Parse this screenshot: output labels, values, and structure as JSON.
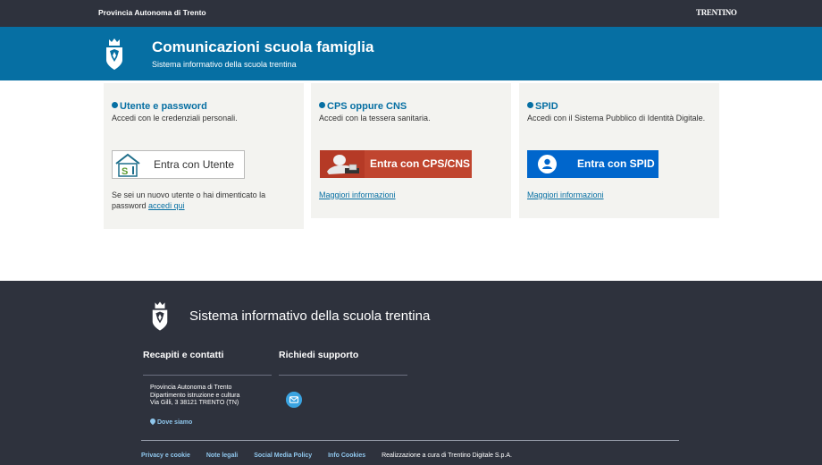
{
  "topbar": {
    "org": "Provincia Autonoma di Trento",
    "brand": "TRENTINO"
  },
  "header": {
    "title": "Comunicazioni scuola famiglia",
    "subtitle": "Sistema informativo della scuola trentina"
  },
  "cards": [
    {
      "title": "Utente e password",
      "desc": "Accedi con le credenziali personali.",
      "button": "Entra con Utente",
      "note_prefix": "Se sei un nuovo utente o hai dimenticato la password",
      "note_link": "accedi qui"
    },
    {
      "title": "CPS oppure CNS",
      "desc": "Accedi con la tessera sanitaria.",
      "button": "Entra con CPS/CNS",
      "more": "Maggiori informazioni"
    },
    {
      "title": "SPID",
      "desc": "Accedi con il Sistema Pubblico di Identità Digitale.",
      "button": "Entra con SPID",
      "more": "Maggiori informazioni"
    }
  ],
  "footer": {
    "title": "Sistema informativo della scuola trentina",
    "contacts_title": "Recapiti e contatti",
    "support_title": "Richiedi supporto",
    "address": [
      "Provincia Autonoma di Trento",
      "Dipartimento istruzione e cultura",
      "Via Gilli, 3 38121 TRENTO (TN)"
    ],
    "where": "Dove siamo",
    "links": [
      "Privacy e cookie",
      "Note legali",
      "Social Media Policy",
      "Info Cookies"
    ],
    "credit": "Realizzazione a cura di Trentino Digitale S.p.A."
  },
  "colors": {
    "header_blue": "#066fa3",
    "dark": "#2e323d",
    "cps_red": "#c0452f",
    "spid_blue": "#0066cc"
  },
  "icons": [
    "crest-icon",
    "user-badge-icon",
    "card-reader-icon",
    "spid-user-icon",
    "mail-icon",
    "map-pin-icon"
  ]
}
